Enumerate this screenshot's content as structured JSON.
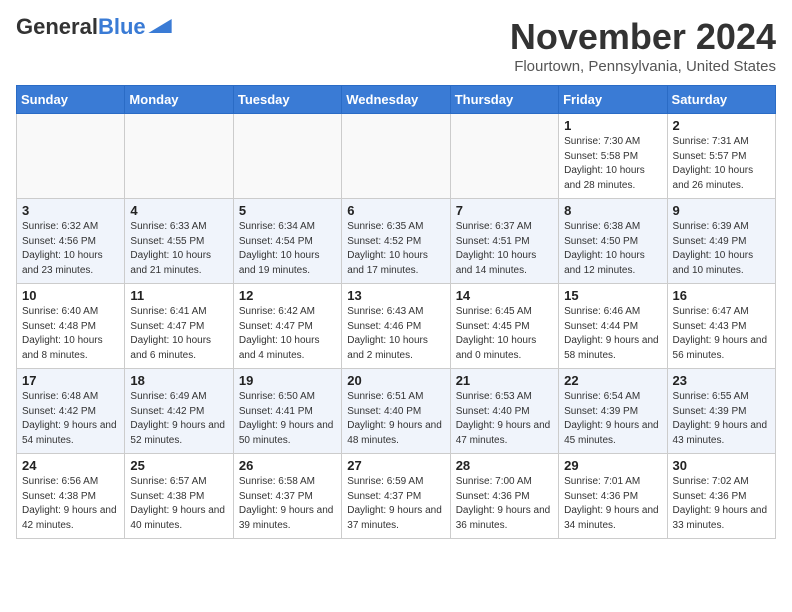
{
  "header": {
    "logo_line1": "General",
    "logo_line2": "Blue",
    "month_title": "November 2024",
    "location": "Flourtown, Pennsylvania, United States"
  },
  "days_of_week": [
    "Sunday",
    "Monday",
    "Tuesday",
    "Wednesday",
    "Thursday",
    "Friday",
    "Saturday"
  ],
  "weeks": [
    [
      {
        "day": "",
        "info": ""
      },
      {
        "day": "",
        "info": ""
      },
      {
        "day": "",
        "info": ""
      },
      {
        "day": "",
        "info": ""
      },
      {
        "day": "",
        "info": ""
      },
      {
        "day": "1",
        "info": "Sunrise: 7:30 AM\nSunset: 5:58 PM\nDaylight: 10 hours and 28 minutes."
      },
      {
        "day": "2",
        "info": "Sunrise: 7:31 AM\nSunset: 5:57 PM\nDaylight: 10 hours and 26 minutes."
      }
    ],
    [
      {
        "day": "3",
        "info": "Sunrise: 6:32 AM\nSunset: 4:56 PM\nDaylight: 10 hours and 23 minutes."
      },
      {
        "day": "4",
        "info": "Sunrise: 6:33 AM\nSunset: 4:55 PM\nDaylight: 10 hours and 21 minutes."
      },
      {
        "day": "5",
        "info": "Sunrise: 6:34 AM\nSunset: 4:54 PM\nDaylight: 10 hours and 19 minutes."
      },
      {
        "day": "6",
        "info": "Sunrise: 6:35 AM\nSunset: 4:52 PM\nDaylight: 10 hours and 17 minutes."
      },
      {
        "day": "7",
        "info": "Sunrise: 6:37 AM\nSunset: 4:51 PM\nDaylight: 10 hours and 14 minutes."
      },
      {
        "day": "8",
        "info": "Sunrise: 6:38 AM\nSunset: 4:50 PM\nDaylight: 10 hours and 12 minutes."
      },
      {
        "day": "9",
        "info": "Sunrise: 6:39 AM\nSunset: 4:49 PM\nDaylight: 10 hours and 10 minutes."
      }
    ],
    [
      {
        "day": "10",
        "info": "Sunrise: 6:40 AM\nSunset: 4:48 PM\nDaylight: 10 hours and 8 minutes."
      },
      {
        "day": "11",
        "info": "Sunrise: 6:41 AM\nSunset: 4:47 PM\nDaylight: 10 hours and 6 minutes."
      },
      {
        "day": "12",
        "info": "Sunrise: 6:42 AM\nSunset: 4:47 PM\nDaylight: 10 hours and 4 minutes."
      },
      {
        "day": "13",
        "info": "Sunrise: 6:43 AM\nSunset: 4:46 PM\nDaylight: 10 hours and 2 minutes."
      },
      {
        "day": "14",
        "info": "Sunrise: 6:45 AM\nSunset: 4:45 PM\nDaylight: 10 hours and 0 minutes."
      },
      {
        "day": "15",
        "info": "Sunrise: 6:46 AM\nSunset: 4:44 PM\nDaylight: 9 hours and 58 minutes."
      },
      {
        "day": "16",
        "info": "Sunrise: 6:47 AM\nSunset: 4:43 PM\nDaylight: 9 hours and 56 minutes."
      }
    ],
    [
      {
        "day": "17",
        "info": "Sunrise: 6:48 AM\nSunset: 4:42 PM\nDaylight: 9 hours and 54 minutes."
      },
      {
        "day": "18",
        "info": "Sunrise: 6:49 AM\nSunset: 4:42 PM\nDaylight: 9 hours and 52 minutes."
      },
      {
        "day": "19",
        "info": "Sunrise: 6:50 AM\nSunset: 4:41 PM\nDaylight: 9 hours and 50 minutes."
      },
      {
        "day": "20",
        "info": "Sunrise: 6:51 AM\nSunset: 4:40 PM\nDaylight: 9 hours and 48 minutes."
      },
      {
        "day": "21",
        "info": "Sunrise: 6:53 AM\nSunset: 4:40 PM\nDaylight: 9 hours and 47 minutes."
      },
      {
        "day": "22",
        "info": "Sunrise: 6:54 AM\nSunset: 4:39 PM\nDaylight: 9 hours and 45 minutes."
      },
      {
        "day": "23",
        "info": "Sunrise: 6:55 AM\nSunset: 4:39 PM\nDaylight: 9 hours and 43 minutes."
      }
    ],
    [
      {
        "day": "24",
        "info": "Sunrise: 6:56 AM\nSunset: 4:38 PM\nDaylight: 9 hours and 42 minutes."
      },
      {
        "day": "25",
        "info": "Sunrise: 6:57 AM\nSunset: 4:38 PM\nDaylight: 9 hours and 40 minutes."
      },
      {
        "day": "26",
        "info": "Sunrise: 6:58 AM\nSunset: 4:37 PM\nDaylight: 9 hours and 39 minutes."
      },
      {
        "day": "27",
        "info": "Sunrise: 6:59 AM\nSunset: 4:37 PM\nDaylight: 9 hours and 37 minutes."
      },
      {
        "day": "28",
        "info": "Sunrise: 7:00 AM\nSunset: 4:36 PM\nDaylight: 9 hours and 36 minutes."
      },
      {
        "day": "29",
        "info": "Sunrise: 7:01 AM\nSunset: 4:36 PM\nDaylight: 9 hours and 34 minutes."
      },
      {
        "day": "30",
        "info": "Sunrise: 7:02 AM\nSunset: 4:36 PM\nDaylight: 9 hours and 33 minutes."
      }
    ]
  ]
}
